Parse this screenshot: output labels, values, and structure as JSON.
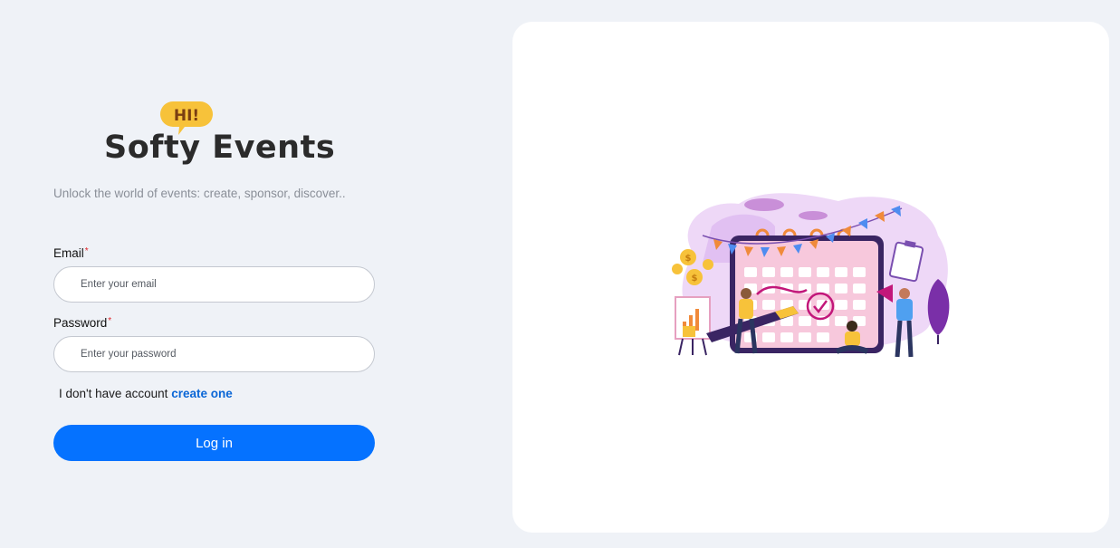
{
  "brand": {
    "badge": "HI!",
    "title": "Softy Events",
    "tagline": "Unlock the world of events: create, sponsor, discover..",
    "badge_color": "#f7c23a"
  },
  "login_form": {
    "email": {
      "label": "Email",
      "required_mark": "*",
      "value": "",
      "placeholder": "Enter your email"
    },
    "password": {
      "label": "Password",
      "required_mark": "*",
      "value": "",
      "placeholder": "Enter your password"
    },
    "signup_prompt": "I don't have account",
    "signup_link": "create one",
    "submit_label": "Log in"
  },
  "colors": {
    "background": "#eff2f7",
    "primary": "#0572ff",
    "link": "#0a66d6",
    "required": "#e0262b",
    "card": "#ffffff"
  },
  "illustration": {
    "icon": "event-calendar-illustration"
  }
}
